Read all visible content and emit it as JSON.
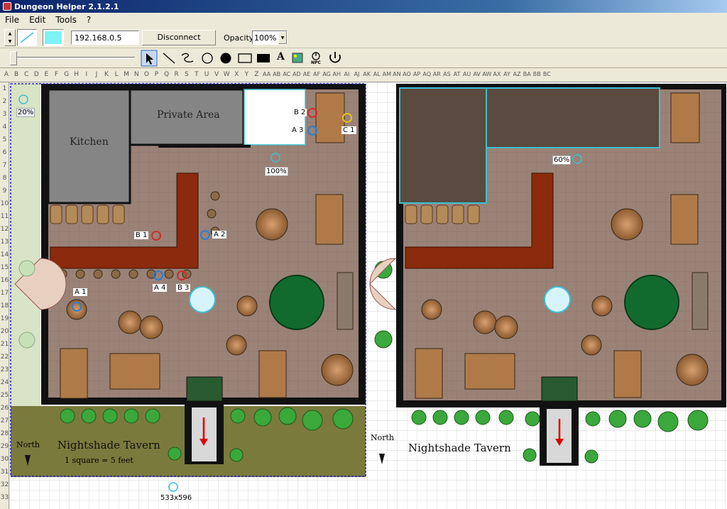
{
  "app": {
    "title": "Dungeon Helper 2.1.2.1"
  },
  "menu": [
    "File",
    "Edit",
    "Tools",
    "?"
  ],
  "toolbar": {
    "ip_value": "192.168.0.5",
    "disconnect_label": "Disconnect",
    "opacity_label": "Opacity:",
    "opacity_value": "100%",
    "npc_label": "NPC",
    "text_tool_label": "A",
    "pen_color": "#7df3f7"
  },
  "columns": [
    "A",
    "B",
    "C",
    "D",
    "E",
    "F",
    "G",
    "H",
    "I",
    "J",
    "K",
    "L",
    "M",
    "N",
    "O",
    "P",
    "Q",
    "R",
    "S",
    "T",
    "U",
    "V",
    "W",
    "X",
    "Y",
    "Z",
    "AA",
    "AB",
    "AC",
    "AD",
    "AE",
    "AF",
    "AG",
    "AH",
    "AI",
    "AJ",
    "AK",
    "AL",
    "AM",
    "AN",
    "AO",
    "AP",
    "AQ",
    "AR",
    "AS",
    "AT",
    "AU",
    "AV",
    "AW",
    "AX",
    "AY",
    "AZ",
    "BA",
    "BB",
    "BC"
  ],
  "rows": [
    "1",
    "2",
    "3",
    "4",
    "5",
    "6",
    "7",
    "8",
    "9",
    "10",
    "11",
    "12",
    "13",
    "14",
    "15",
    "16",
    "17",
    "18",
    "19",
    "20",
    "21",
    "22",
    "23",
    "24",
    "25",
    "26",
    "27",
    "28",
    "29",
    "30",
    "31",
    "32",
    "33"
  ],
  "map_left": {
    "kitchen_label": "Kitchen",
    "private_label": "Private Area",
    "title": "Nightshade Tavern",
    "scale": "1 square = 5 feet",
    "north": "North",
    "size_label": "533x596",
    "light_left": "20%",
    "light_top": "100%",
    "tokens": [
      {
        "id": "A 1",
        "color": "#2a7fd4"
      },
      {
        "id": "A 2",
        "color": "#2a7fd4"
      },
      {
        "id": "A 3",
        "color": "#2a7fd4"
      },
      {
        "id": "A 4",
        "color": "#2a7fd4"
      },
      {
        "id": "B 1",
        "color": "#d42a2a"
      },
      {
        "id": "B 2",
        "color": "#d42a2a"
      },
      {
        "id": "B 3",
        "color": "#d42a2a"
      },
      {
        "id": "C 1",
        "color": "#e8c21a"
      }
    ]
  },
  "map_right": {
    "title": "Nightshade Tavern",
    "north": "North",
    "light_label": "60%"
  },
  "colors": {
    "floor": "#9a8277",
    "wall": "#111111",
    "bar": "#8b2a0c",
    "grass": "#7a7a3c",
    "gray_room": "#858585",
    "light": "#3cc0d0"
  }
}
